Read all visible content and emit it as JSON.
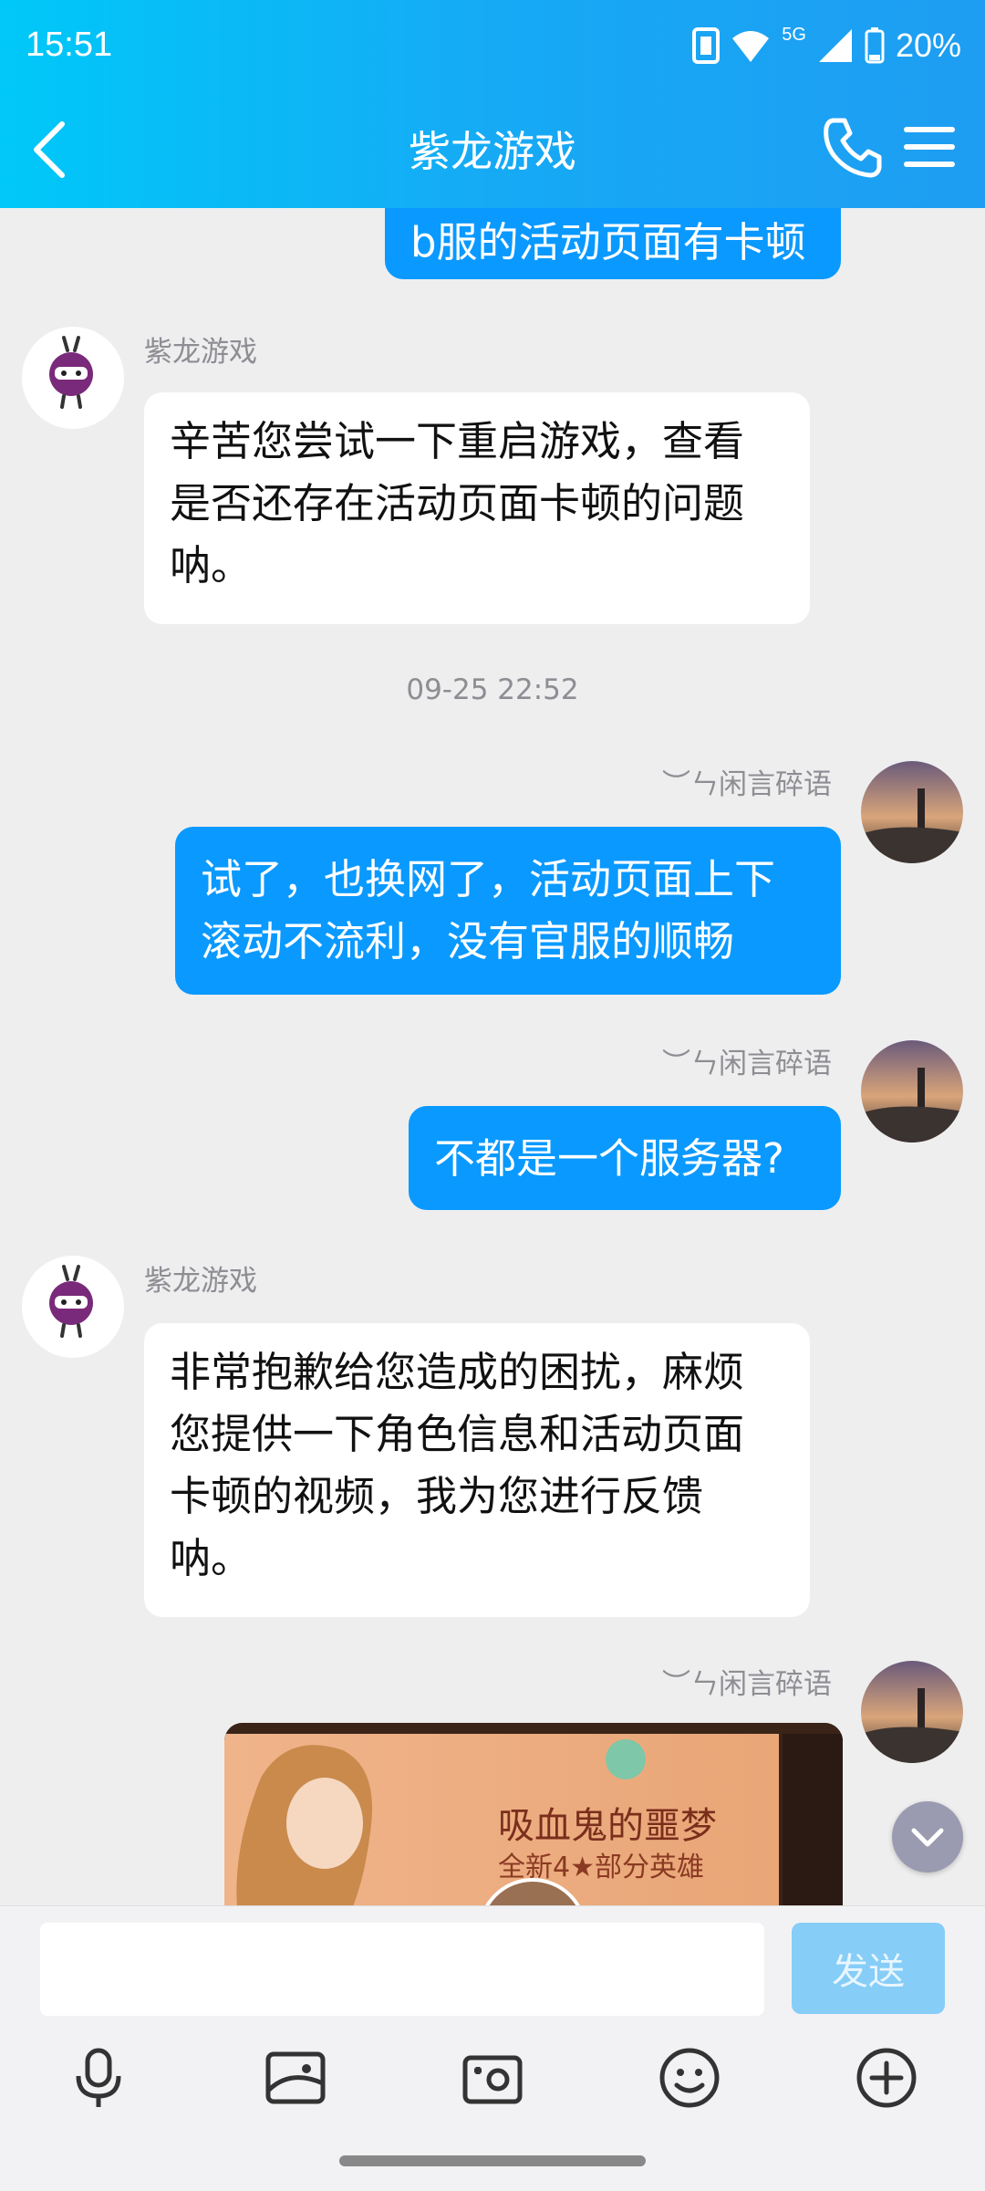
{
  "status_bar": {
    "time": "15:51",
    "network": "5G",
    "battery": "20%"
  },
  "header": {
    "title": "紫龙游戏"
  },
  "messages": [
    {
      "side": "right",
      "text": "b服的活动页面有卡顿"
    },
    {
      "side": "left",
      "sender": "紫龙游戏",
      "text": "辛苦您尝试一下重启游戏，查看是否还存在活动页面卡顿的问题呐。"
    },
    {
      "type": "timestamp",
      "text": "09-25 22:52"
    },
    {
      "side": "right",
      "sender": "︶ㄣ闲言碎语",
      "text": "试了，也换网了，活动页面上下滚动不流利，没有官服的顺畅"
    },
    {
      "side": "right",
      "sender": "︶ㄣ闲言碎语",
      "text": "不都是一个服务器?"
    },
    {
      "side": "left",
      "sender": "紫龙游戏",
      "text": "非常抱歉给您造成的困扰，麻烦您提供一下角色信息和活动页面卡顿的视频，我为您进行反馈呐。"
    },
    {
      "side": "right",
      "sender": "︶ㄣ闲言碎语",
      "type": "video",
      "video_title": "吸血鬼的噩梦",
      "video_subtitle": "全新4★部分英雄"
    }
  ],
  "input": {
    "placeholder": "",
    "send_label": "发送"
  },
  "toolbar": [
    "microphone-icon",
    "image-icon",
    "camera-icon",
    "emoji-icon",
    "plus-icon"
  ],
  "colors": {
    "header_start": "#00c8f8",
    "header_end": "#1e9df2",
    "bubble_out": "#0a99ff",
    "bubble_in": "#ffffff"
  }
}
